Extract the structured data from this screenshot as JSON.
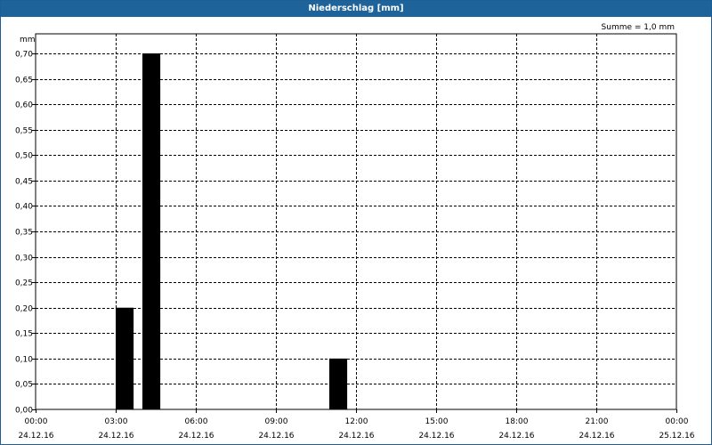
{
  "chart_data": {
    "type": "bar",
    "title": "Niederschlag [mm]",
    "ylabel": "mm",
    "summary": "Summe = 1,0 mm",
    "ylim": [
      0,
      0.75
    ],
    "yticks": [
      0,
      0.05,
      0.1,
      0.15,
      0.2,
      0.25,
      0.3,
      0.35,
      0.4,
      0.45,
      0.5,
      0.55,
      0.6,
      0.65,
      0.7
    ],
    "ytick_labels": [
      "0,00",
      "0,05",
      "0,10",
      "0,15",
      "0,20",
      "0,25",
      "0,30",
      "0,35",
      "0,40",
      "0,45",
      "0,50",
      "0,55",
      "0,60",
      "0,65",
      "0,70"
    ],
    "xlim_hours": [
      0,
      24
    ],
    "xticks_hours": [
      0,
      3,
      6,
      9,
      12,
      15,
      18,
      21,
      24
    ],
    "xtick_labels": [
      {
        "time": "00:00",
        "date": "24.12.16"
      },
      {
        "time": "03:00",
        "date": "24.12.16"
      },
      {
        "time": "06:00",
        "date": "24.12.16"
      },
      {
        "time": "09:00",
        "date": "24.12.16"
      },
      {
        "time": "12:00",
        "date": "24.12.16"
      },
      {
        "time": "15:00",
        "date": "24.12.16"
      },
      {
        "time": "18:00",
        "date": "24.12.16"
      },
      {
        "time": "21:00",
        "date": "24.12.16"
      },
      {
        "time": "00:00",
        "date": "25.12.16"
      }
    ],
    "grid": true,
    "bar_color": "#000000",
    "bars": [
      {
        "start_hour": 3.0,
        "end_hour": 3.67,
        "value": 0.2
      },
      {
        "start_hour": 4.0,
        "end_hour": 4.67,
        "value": 0.7
      },
      {
        "start_hour": 11.0,
        "end_hour": 11.67,
        "value": 0.1
      }
    ]
  }
}
